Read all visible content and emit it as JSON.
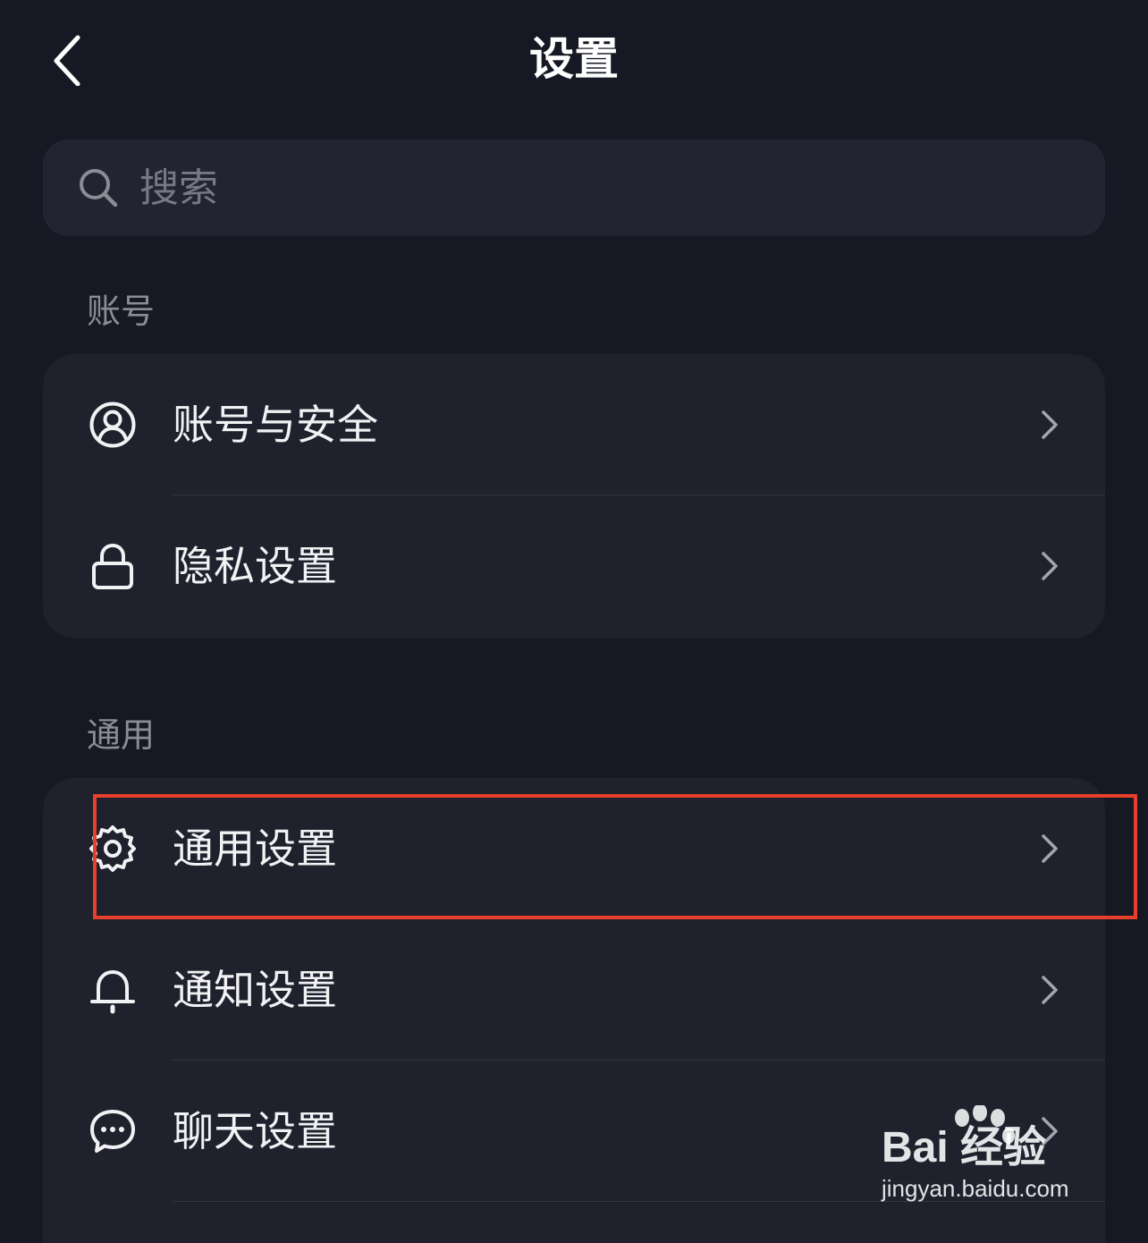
{
  "header": {
    "title": "设置"
  },
  "search": {
    "placeholder": "搜索"
  },
  "sections": [
    {
      "label": "账号",
      "items": [
        {
          "label": "账号与安全",
          "icon": "user-circle-icon"
        },
        {
          "label": "隐私设置",
          "icon": "lock-icon"
        }
      ]
    },
    {
      "label": "通用",
      "items": [
        {
          "label": "通用设置",
          "icon": "gear-icon",
          "highlighted": true
        },
        {
          "label": "通知设置",
          "icon": "bell-icon"
        },
        {
          "label": "聊天设置",
          "icon": "chat-bubble-icon"
        }
      ]
    }
  ],
  "watermark": {
    "logo": "Bai 经验",
    "url": "jingyan.baidu.com"
  },
  "colors": {
    "background": "#161823",
    "card": "#1f212d",
    "search_bg": "#222431",
    "highlight": "#e8402a",
    "section_label": "#8a8c96"
  }
}
